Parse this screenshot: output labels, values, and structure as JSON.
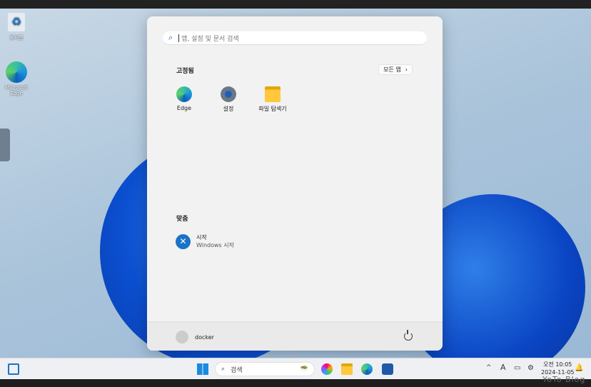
{
  "desktop": {
    "icons": [
      {
        "label": "휴지통"
      },
      {
        "label": "Microsoft Edge"
      }
    ]
  },
  "start_menu": {
    "search_placeholder": "앱, 설정 및 문서 검색",
    "pinned_title": "고정됨",
    "all_apps_label": "모든 앱",
    "pinned": [
      {
        "label": "Edge"
      },
      {
        "label": "설정"
      },
      {
        "label": "파일 탐색기"
      }
    ],
    "recommended_title": "맞춤",
    "recommended": [
      {
        "title": "시작",
        "subtitle": "Windows 시작"
      }
    ],
    "user": "docker"
  },
  "taskbar": {
    "search_label": "검색",
    "time": "오전 10:05",
    "date": "2024-11-05"
  },
  "watermark": "YoTo Blog"
}
